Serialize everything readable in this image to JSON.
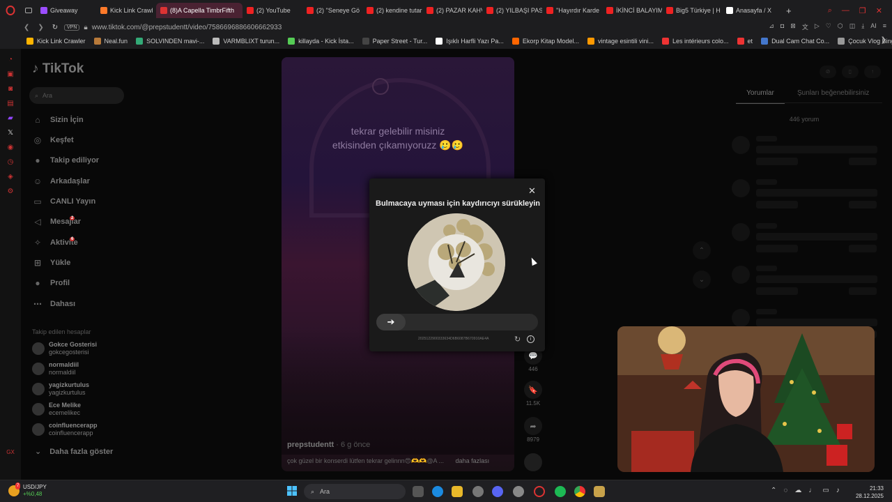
{
  "browser": {
    "tabs": [
      {
        "title": "Giveaway",
        "color": "#9b4dff"
      },
      {
        "title": "Kick Link Crawl",
        "color": "#ff7a2a"
      },
      {
        "title": "(8)A Capella TimbrFifth",
        "color": "#d33"
      },
      {
        "title": "(2) YouTube",
        "color": "#e22"
      },
      {
        "title": "(2) ''Seneye Gö",
        "color": "#e22"
      },
      {
        "title": "(2) kendine tutar",
        "color": "#e22"
      },
      {
        "title": "(2) PAZAR KAHV",
        "color": "#e22"
      },
      {
        "title": "(2) YILBAŞI PAS",
        "color": "#e22"
      },
      {
        "title": "''Hayırdır Karde",
        "color": "#e22"
      },
      {
        "title": "İKİNCİ BALAYIM",
        "color": "#e22"
      },
      {
        "title": "Big5 Türkiye | H",
        "color": "#e22"
      },
      {
        "title": "Anasayfa / X",
        "color": "#fff"
      }
    ],
    "active_tab_index": 2,
    "vpn_label": "VPN",
    "url": "www.tiktok.com/@prepstudentt/video/7586696886606662933",
    "ai_label": "AI",
    "bookmarks": [
      {
        "label": "Kick Link Crawler",
        "color": "#ffb400"
      },
      {
        "label": "Neal.fun",
        "color": "#b87a3a"
      },
      {
        "label": "SOLVINDEN mavi-...",
        "color": "#3a7"
      },
      {
        "label": "VARMBLIXT turun...",
        "color": "#bbb"
      },
      {
        "label": "killayda - Kick İsta...",
        "color": "#5c5"
      },
      {
        "label": "Paper Street - Tur...",
        "color": "#444"
      },
      {
        "label": "Işıklı Harfli Yazı Pa...",
        "color": "#fff"
      },
      {
        "label": "Ekorp Kitap Model...",
        "color": "#f60"
      },
      {
        "label": "vintage esintili vini...",
        "color": "#f90"
      },
      {
        "label": "Les intérieurs colo...",
        "color": "#e33"
      },
      {
        "label": "et",
        "color": "#e33"
      },
      {
        "label": "Dual Cam Chat Co...",
        "color": "#47c"
      },
      {
        "label": "Çocuk Vlog Bingosu",
        "color": "#999"
      }
    ]
  },
  "tiktok": {
    "logo": "TikTok",
    "search_placeholder": "Ara",
    "nav": [
      {
        "label": "Sizin İçin",
        "icon": "home-icon",
        "glyph": "⌂"
      },
      {
        "label": "Keşfet",
        "icon": "compass-icon",
        "glyph": "◎"
      },
      {
        "label": "Takip ediliyor",
        "icon": "following-icon",
        "glyph": "●"
      },
      {
        "label": "Arkadaşlar",
        "icon": "friends-icon",
        "glyph": "☺"
      },
      {
        "label": "CANLI Yayın",
        "icon": "live-icon",
        "glyph": "▭"
      },
      {
        "label": "Mesajlar",
        "icon": "messages-icon",
        "glyph": "◁",
        "badge": "2"
      },
      {
        "label": "Aktivite",
        "icon": "activity-icon",
        "glyph": "✧",
        "badge": "6"
      },
      {
        "label": "Yükle",
        "icon": "upload-icon",
        "glyph": "⊞"
      },
      {
        "label": "Profil",
        "icon": "profile-icon",
        "glyph": "●"
      },
      {
        "label": "Dahası",
        "icon": "more-icon",
        "glyph": "⋯"
      }
    ],
    "following_title": "Takip edilen hesaplar",
    "accounts": [
      {
        "name": "Gokce Gosterisi",
        "handle": "gokcegosterisi"
      },
      {
        "name": "normaldiil",
        "handle": "normaldiil"
      },
      {
        "name": "yagizkurtulus",
        "handle": "yagizkurtulus"
      },
      {
        "name": "Ece Melike",
        "handle": "ecemelikec"
      },
      {
        "name": "coinfluencerapp",
        "handle": "coinfluencerapp"
      }
    ],
    "show_more": "Daha fazla göster",
    "video": {
      "caption_line1": "tekrar gelebilir misiniz",
      "caption_line2": "etkisinden çıkamıyoruzz 🥲🥲",
      "author": "prepstudentt",
      "age": " · 6 g önce",
      "description": "çok güzel bir konserdi lütfen tekrar gelinnn😍🫶🫶@A ...",
      "more": "daha fazlası"
    },
    "actions": [
      {
        "icon": "comment-icon",
        "glyph": "💬",
        "count": "446"
      },
      {
        "icon": "bookmark-icon",
        "glyph": "🔖",
        "count": "11.5K"
      },
      {
        "icon": "share-icon",
        "glyph": "➦",
        "count": "8979"
      }
    ],
    "right_panel": {
      "tab_comments": "Yorumlar",
      "tab_suggested": "Şunları beğenebilirsiniz",
      "comment_count": "446 yorum"
    }
  },
  "captcha": {
    "title": "Bulmacaya uyması için kaydırıcıyı sürükleyin",
    "close": "✕",
    "slider_arrow": "➔",
    "id": "2025122900333634D6B6087B670910AE4A",
    "refresh": "↻",
    "info": "i"
  },
  "taskbar": {
    "ticker_pair": "USD/JPY",
    "ticker_change": "+%0,48",
    "ticker_badge": "7",
    "search_placeholder": "Ara",
    "time": "21:33",
    "date": "28.12.2025"
  }
}
